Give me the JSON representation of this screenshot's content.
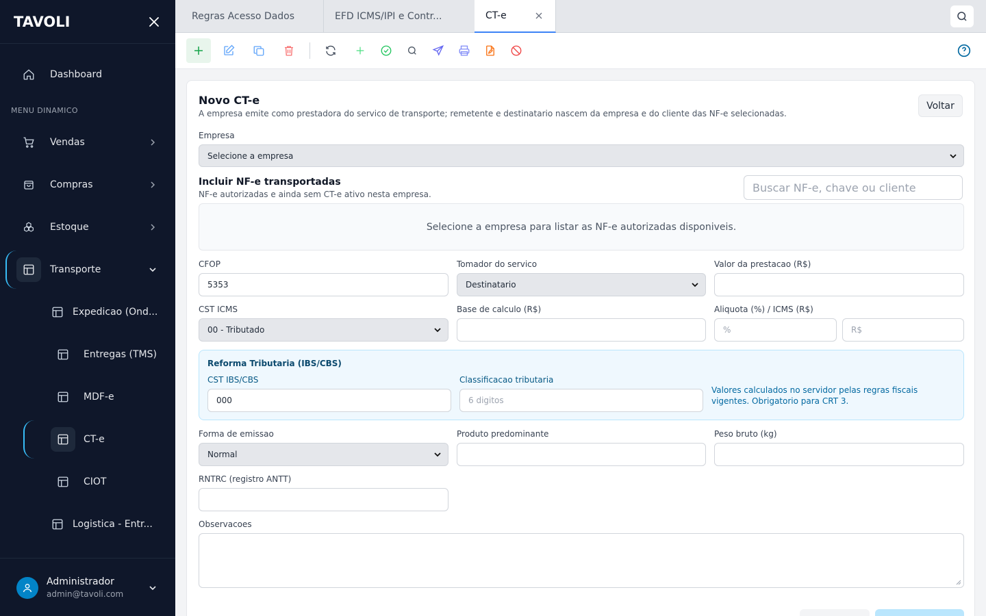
{
  "app": {
    "logo": "TAVOLI"
  },
  "sidebar": {
    "section_label": "MENU DINAMICO",
    "items": [
      {
        "label": "Dashboard",
        "icon": "home-icon"
      },
      {
        "label": "Vendas",
        "icon": "cart-icon"
      },
      {
        "label": "Compras",
        "icon": "bag-icon"
      },
      {
        "label": "Estoque",
        "icon": "boxes-icon"
      },
      {
        "label": "Transporte",
        "icon": "layout-icon"
      },
      {
        "label": "Expedicao (Ond...",
        "icon": "layout-icon"
      },
      {
        "label": "Entregas (TMS)",
        "icon": "layout-icon"
      },
      {
        "label": "MDF-e",
        "icon": "layout-icon"
      },
      {
        "label": "CT-e",
        "icon": "layout-icon"
      },
      {
        "label": "CIOT",
        "icon": "layout-icon"
      },
      {
        "label": "Logistica - Entr...",
        "icon": "layout-icon"
      }
    ],
    "user": {
      "name": "Administrador",
      "email": "admin@tavoli.com"
    }
  },
  "tabs": [
    {
      "label": "Regras Acesso Dados"
    },
    {
      "label": "EFD ICMS/IPI e Contr..."
    },
    {
      "label": "CT-e"
    }
  ],
  "form": {
    "title": "Novo CT-e",
    "subtitle": "A empresa emite como prestadora do servico de transporte; remetente e destinatario nascem da empresa e do cliente das NF-e selecionadas.",
    "back_label": "Voltar",
    "empresa_label": "Empresa",
    "empresa_value": "Selecione a empresa",
    "nfe_title": "Incluir NF-e transportadas",
    "nfe_sub": "NF-e autorizadas e ainda sem CT-e ativo nesta empresa.",
    "nfe_search_placeholder": "Buscar NF-e, chave ou cliente",
    "nfe_empty": "Selecione a empresa para listar as NF-e autorizadas disponiveis.",
    "cfop_label": "CFOP",
    "cfop_value": "5353",
    "tomador_label": "Tomador do servico",
    "tomador_value": "Destinatario",
    "valor_label": "Valor da prestacao (R$)",
    "cst_label": "CST ICMS",
    "cst_value": "00 - Tributado",
    "base_label": "Base de calculo (R$)",
    "aliq_label": "Aliquota (%) / ICMS (R$)",
    "aliq_ph": "%",
    "icms_ph": "R$",
    "reforma_title": "Reforma Tributaria (IBS/CBS)",
    "cst_ibs_label": "CST IBS/CBS",
    "cst_ibs_value": "000",
    "class_label": "Classificacao tributaria",
    "class_ph": "6 digitos",
    "reforma_note": "Valores calculados no servidor pelas regras fiscais vigentes. Obrigatorio para CRT 3.",
    "forma_label": "Forma de emissao",
    "forma_value": "Normal",
    "produto_label": "Produto predominante",
    "peso_label": "Peso bruto (kg)",
    "rntrc_label": "RNTRC (registro ANTT)",
    "obs_label": "Observacoes"
  }
}
